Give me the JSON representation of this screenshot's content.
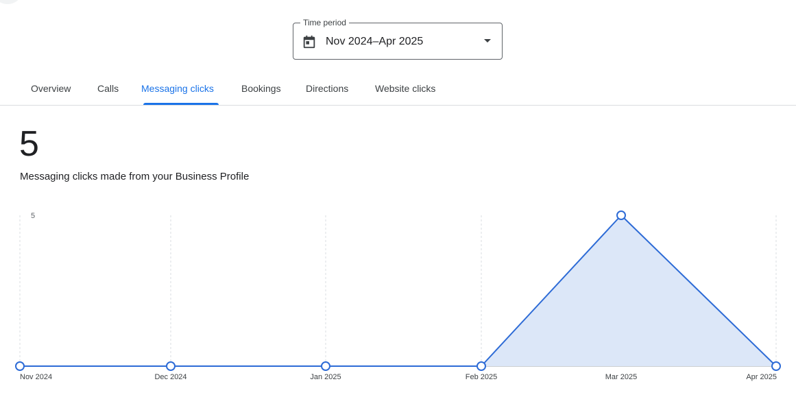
{
  "time_period": {
    "label": "Time period",
    "value": "Nov 2024–Apr 2025"
  },
  "tabs": [
    {
      "label": "Overview",
      "active": false
    },
    {
      "label": "Calls",
      "active": false
    },
    {
      "label": "Messaging clicks",
      "active": true
    },
    {
      "label": "Bookings",
      "active": false
    },
    {
      "label": "Directions",
      "active": false
    },
    {
      "label": "Website clicks",
      "active": false
    }
  ],
  "metric": {
    "total": "5",
    "caption": "Messaging clicks made from your Business Profile"
  },
  "colors": {
    "accent": "#1a73e8",
    "line": "#2d6bd6",
    "fill": "#dce7f8"
  },
  "chart_data": {
    "type": "area",
    "title": "",
    "xlabel": "",
    "ylabel": "",
    "ylim": [
      0,
      5
    ],
    "y_ticks": [
      "5"
    ],
    "grid": "vertical dashed",
    "categories": [
      "Nov 2024",
      "Dec 2024",
      "Jan 2025",
      "Feb 2025",
      "Mar 2025",
      "Apr 2025"
    ],
    "series": [
      {
        "values": [
          0,
          0,
          0,
          0,
          5,
          0
        ]
      }
    ]
  }
}
